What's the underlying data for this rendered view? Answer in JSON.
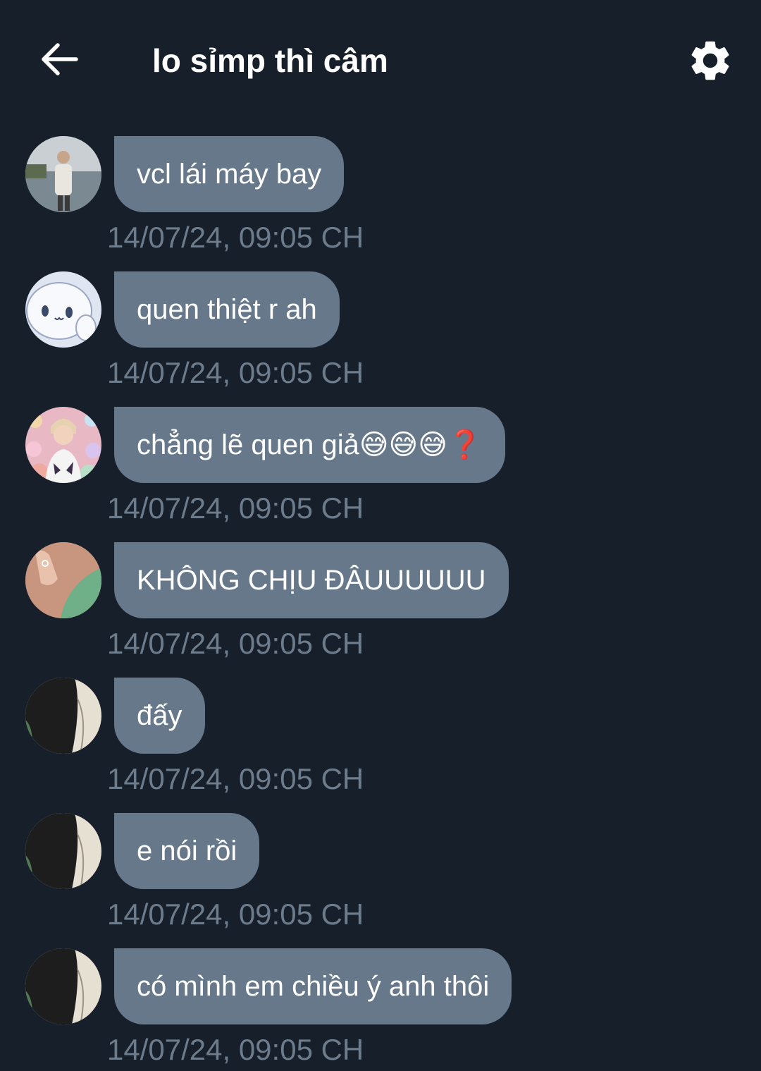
{
  "header": {
    "title": "lo sỉmp thì câm",
    "back_icon": "arrow-left-icon",
    "settings_icon": "gear-icon"
  },
  "colors": {
    "background": "#17202a",
    "bubble": "#66788a",
    "timestamp": "#6d7c8c",
    "text": "#ffffff"
  },
  "messages": [
    {
      "text": "vcl lái máy bay",
      "time": "14/07/24, 09:05 CH",
      "avatar": "avatar-boy-lake"
    },
    {
      "text": "quen thiệt r ah",
      "time": "14/07/24, 09:05 CH",
      "avatar": "avatar-cinnamoroll"
    },
    {
      "text": "chẳng lẽ quen giả",
      "emoji": "😅😅😅❓",
      "time": "14/07/24, 09:05 CH",
      "avatar": "avatar-boy-toys"
    },
    {
      "text": "KHÔNG CHỊU ĐÂUUUUUU",
      "time": "14/07/24, 09:05 CH",
      "avatar": "avatar-hand-green"
    },
    {
      "text": "đấy",
      "time": "14/07/24, 09:05 CH",
      "avatar": "avatar-dark-photo"
    },
    {
      "text": "e nói rồi",
      "time": "14/07/24, 09:05 CH",
      "avatar": "avatar-dark-photo"
    },
    {
      "text": "có mình em chiều ý anh thôi",
      "time": "14/07/24, 09:05 CH",
      "avatar": "avatar-dark-photo"
    }
  ]
}
